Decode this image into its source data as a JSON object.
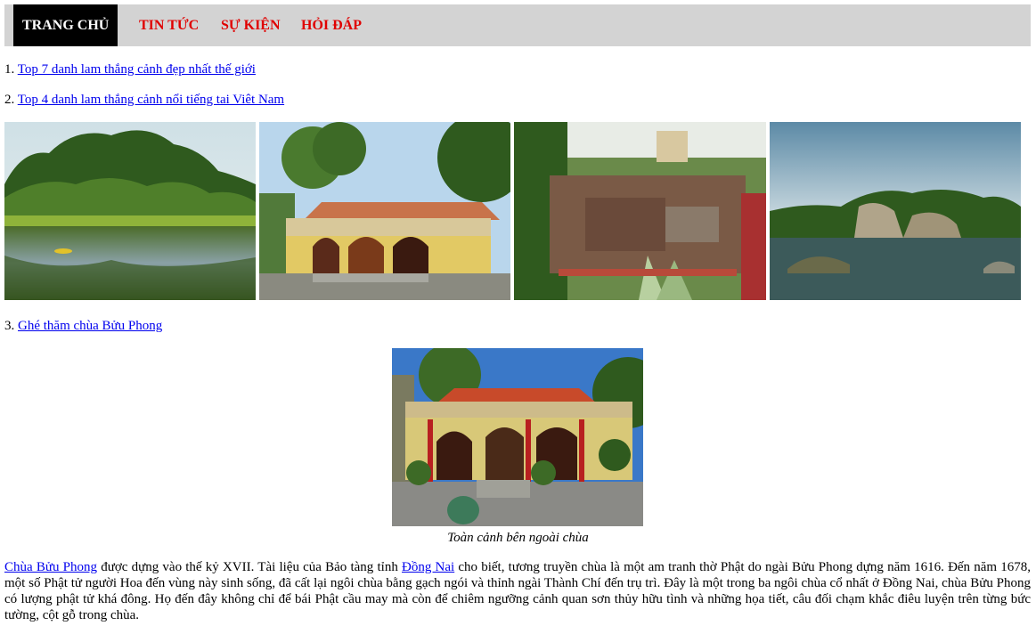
{
  "nav": {
    "items": [
      {
        "label": "TRANG CHỦ",
        "active": true
      },
      {
        "label": "TIN TỨC",
        "active": false
      },
      {
        "label": "SỰ KIỆN",
        "active": false
      },
      {
        "label": "HỎI ĐÁP",
        "active": false
      }
    ]
  },
  "articles": [
    {
      "number": "1.",
      "title": "Top 7 danh lam thắng cảnh đẹp nhất thế giới"
    },
    {
      "number": "2.",
      "title": "Top 4 danh lam thắng cảnh nổi tiếng tai Viêt Nam"
    },
    {
      "number": "3.",
      "title": "Ghé thăm chùa Bửu Phong"
    }
  ],
  "gallery": {
    "images": [
      {
        "name": "lake-forest-photo"
      },
      {
        "name": "pagoda-photo"
      },
      {
        "name": "garden-tomb-photo"
      },
      {
        "name": "rock-lake-photo"
      }
    ]
  },
  "feature": {
    "caption": "Toàn cảnh bên ngoài chùa",
    "link1": "Chùa Bửu Phong",
    "text1": " được dựng vào thế kỷ XVII. Tài liệu của Bảo tàng tỉnh ",
    "link2": "Đồng Nai",
    "text2": " cho biết, tương truyền chùa là một am tranh thờ Phật do ngài Bửu Phong dựng năm 1616. Đến năm 1678, một số Phật tử người Hoa đến vùng này sinh sống, đã cất lại ngôi chùa bằng gạch ngói và thỉnh ngài Thành Chí đến trụ trì. Đây là một trong ba ngôi chùa cổ nhất ở Đồng Nai, chùa Bửu Phong có lượng phật tử khá đông. Họ đến đây không chỉ để bái Phật cầu may mà còn để chiêm ngưỡng cảnh quan sơn thủy hữu tình và những họa tiết, câu đối chạm khắc điêu luyện trên từng bức tường, cột gỗ trong chùa."
  },
  "colors": {
    "nav_bg": "#d3d3d3",
    "nav_active_bg": "#000000",
    "nav_text": "#e00000",
    "link": "#0000ee"
  }
}
